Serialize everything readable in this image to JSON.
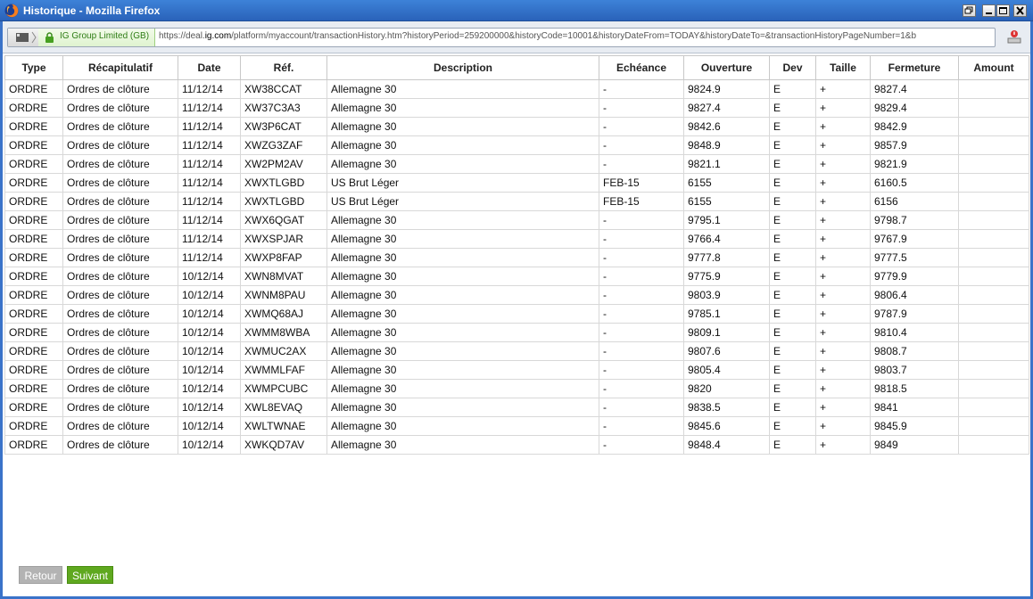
{
  "window": {
    "title": "Historique - Mozilla Firefox",
    "controls": [
      "restore-icon",
      "minimize-icon",
      "maximize-icon",
      "close-icon"
    ]
  },
  "navbar": {
    "identity_label": "IG Group Limited (GB)",
    "url_prefix": "https://deal.",
    "url_domain": "ig.com",
    "url_rest": "/platform/myaccount/transactionHistory.htm?historyPeriod=259200000&historyCode=10001&historyDateFrom=TODAY&historyDateTo=&transactionHistoryPageNumber=1&b"
  },
  "table": {
    "headers": [
      "Type",
      "Récapitulatif",
      "Date",
      "Réf.",
      "Description",
      "Echéance",
      "Ouverture",
      "Dev",
      "Taille",
      "Fermeture",
      "Amount"
    ],
    "rows": [
      [
        "ORDRE",
        "Ordres de clôture",
        "11/12/14",
        "XW38CCAT",
        "Allemagne 30",
        "-",
        "9824.9",
        "E",
        "+",
        "9827.4",
        ""
      ],
      [
        "ORDRE",
        "Ordres de clôture",
        "11/12/14",
        "XW37C3A3",
        "Allemagne 30",
        "-",
        "9827.4",
        "E",
        "+",
        "9829.4",
        ""
      ],
      [
        "ORDRE",
        "Ordres de clôture",
        "11/12/14",
        "XW3P6CAT",
        "Allemagne 30",
        "-",
        "9842.6",
        "E",
        "+",
        "9842.9",
        ""
      ],
      [
        "ORDRE",
        "Ordres de clôture",
        "11/12/14",
        "XWZG3ZAF",
        "Allemagne 30",
        "-",
        "9848.9",
        "E",
        "+",
        "9857.9",
        ""
      ],
      [
        "ORDRE",
        "Ordres de clôture",
        "11/12/14",
        "XW2PM2AV",
        "Allemagne 30",
        "-",
        "9821.1",
        "E",
        "+",
        "9821.9",
        ""
      ],
      [
        "ORDRE",
        "Ordres de clôture",
        "11/12/14",
        "XWXTLGBD",
        "US Brut Léger",
        "FEB-15",
        "6155",
        "E",
        "+",
        "6160.5",
        ""
      ],
      [
        "ORDRE",
        "Ordres de clôture",
        "11/12/14",
        "XWXTLGBD",
        "US Brut Léger",
        "FEB-15",
        "6155",
        "E",
        "+",
        "6156",
        ""
      ],
      [
        "ORDRE",
        "Ordres de clôture",
        "11/12/14",
        "XWX6QGAT",
        "Allemagne 30",
        "-",
        "9795.1",
        "E",
        "+",
        "9798.7",
        ""
      ],
      [
        "ORDRE",
        "Ordres de clôture",
        "11/12/14",
        "XWXSPJAR",
        "Allemagne 30",
        "-",
        "9766.4",
        "E",
        "+",
        "9767.9",
        ""
      ],
      [
        "ORDRE",
        "Ordres de clôture",
        "11/12/14",
        "XWXP8FAP",
        "Allemagne 30",
        "-",
        "9777.8",
        "E",
        "+",
        "9777.5",
        ""
      ],
      [
        "ORDRE",
        "Ordres de clôture",
        "10/12/14",
        "XWN8MVAT",
        "Allemagne 30",
        "-",
        "9775.9",
        "E",
        "+",
        "9779.9",
        ""
      ],
      [
        "ORDRE",
        "Ordres de clôture",
        "10/12/14",
        "XWNM8PAU",
        "Allemagne 30",
        "-",
        "9803.9",
        "E",
        "+",
        "9806.4",
        ""
      ],
      [
        "ORDRE",
        "Ordres de clôture",
        "10/12/14",
        "XWMQ68AJ",
        "Allemagne 30",
        "-",
        "9785.1",
        "E",
        "+",
        "9787.9",
        ""
      ],
      [
        "ORDRE",
        "Ordres de clôture",
        "10/12/14",
        "XWMM8WBA",
        "Allemagne 30",
        "-",
        "9809.1",
        "E",
        "+",
        "9810.4",
        ""
      ],
      [
        "ORDRE",
        "Ordres de clôture",
        "10/12/14",
        "XWMUC2AX",
        "Allemagne 30",
        "-",
        "9807.6",
        "E",
        "+",
        "9808.7",
        ""
      ],
      [
        "ORDRE",
        "Ordres de clôture",
        "10/12/14",
        "XWMMLFAF",
        "Allemagne 30",
        "-",
        "9805.4",
        "E",
        "+",
        "9803.7",
        ""
      ],
      [
        "ORDRE",
        "Ordres de clôture",
        "10/12/14",
        "XWMPCUBC",
        "Allemagne 30",
        "-",
        "9820",
        "E",
        "+",
        "9818.5",
        ""
      ],
      [
        "ORDRE",
        "Ordres de clôture",
        "10/12/14",
        "XWL8EVAQ",
        "Allemagne 30",
        "-",
        "9838.5",
        "E",
        "+",
        "9841",
        ""
      ],
      [
        "ORDRE",
        "Ordres de clôture",
        "10/12/14",
        "XWLTWNAE",
        "Allemagne 30",
        "-",
        "9845.6",
        "E",
        "+",
        "9845.9",
        ""
      ],
      [
        "ORDRE",
        "Ordres de clôture",
        "10/12/14",
        "XWKQD7AV",
        "Allemagne 30",
        "-",
        "9848.4",
        "E",
        "+",
        "9849",
        ""
      ]
    ]
  },
  "pagination": {
    "prev_label": "Retour",
    "next_label": "Suivant"
  },
  "colors": {
    "titlebar": "#2a62b9",
    "next_button": "#5fa81f",
    "prev_button": "#b3b3b3",
    "secure_identity": "#2e7d15"
  }
}
